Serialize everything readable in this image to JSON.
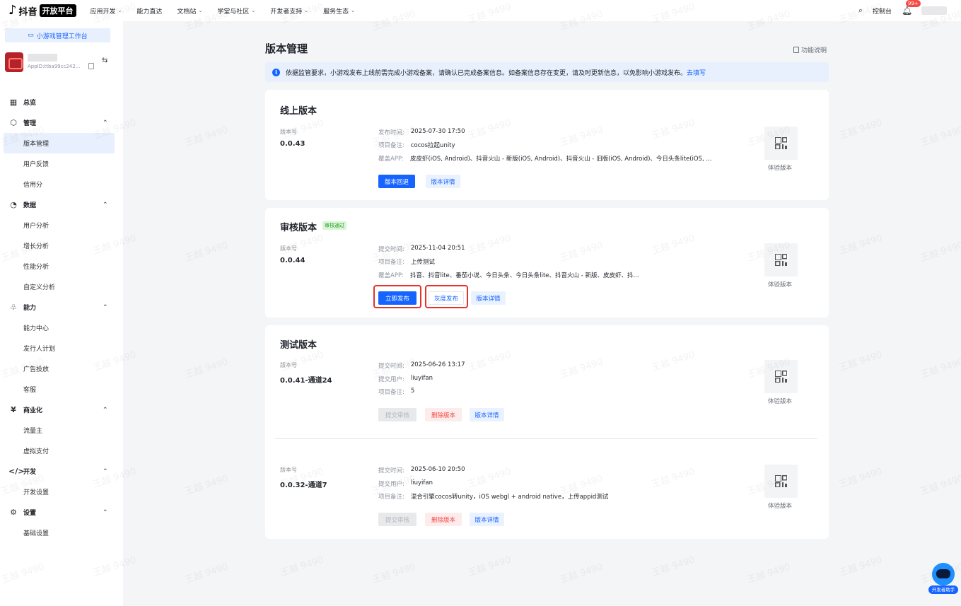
{
  "topnav": {
    "brand": "抖音",
    "badge": "开放平台",
    "items": [
      "应用开发",
      "能力直达",
      "文档站",
      "学堂与社区",
      "开发者支持",
      "服务生态"
    ],
    "console": "控制台",
    "notification_count": "99+"
  },
  "sidebar": {
    "workbench": "小游戏管理工作台",
    "app_id": "AppID:ttba99cc242...",
    "menu": [
      {
        "group": "总览",
        "icon": "overview-icon",
        "glyph": "▦",
        "expandable": false,
        "items": []
      },
      {
        "group": "管理",
        "icon": "cube-icon",
        "glyph": "⬡",
        "expandable": true,
        "items": [
          "版本管理",
          "用户反馈",
          "信用分"
        ]
      },
      {
        "group": "数据",
        "icon": "pie-chart-icon",
        "glyph": "◔",
        "expandable": true,
        "items": [
          "用户分析",
          "增长分析",
          "性能分析",
          "自定义分析"
        ]
      },
      {
        "group": "能力",
        "icon": "capability-icon",
        "glyph": "♧",
        "expandable": true,
        "items": [
          "能力中心",
          "发行人计划",
          "广告投放",
          "客服"
        ]
      },
      {
        "group": "商业化",
        "icon": "coin-icon",
        "glyph": "¥",
        "expandable": true,
        "items": [
          "流量主",
          "虚拟支付"
        ]
      },
      {
        "group": "开发",
        "icon": "code-icon",
        "glyph": "</>",
        "expandable": true,
        "items": [
          "开发设置"
        ]
      },
      {
        "group": "设置",
        "icon": "settings-icon",
        "glyph": "⚙",
        "expandable": true,
        "items": [
          "基础设置"
        ]
      }
    ],
    "active": "版本管理"
  },
  "main": {
    "title": "版本管理",
    "help": "功能说明",
    "notice": "依据监管要求，小游戏发布上线前需完成小游戏备案，请确认已完成备案信息。如备案信息存在变更，请及时更新信息，以免影响小游戏发布。",
    "notice_link": "去填写",
    "online": {
      "title": "线上版本",
      "ver_label": "版本号",
      "version": "0.0.43",
      "rows": [
        {
          "k": "发布时间:",
          "v": "2025-07-30 17:50"
        },
        {
          "k": "项目备注:",
          "v": "cocos拉起unity"
        },
        {
          "k": "覆盖APP:",
          "v": "皮皮虾(iOS, Android)、抖音火山 - 新版(iOS, Android)、抖音火山 - 旧版(iOS, Android)、今日头条lite(iOS, ..."
        }
      ],
      "btn_rollback": "版本回退",
      "btn_detail": "版本详情",
      "qr_label": "体验版本"
    },
    "review": {
      "title": "审核版本",
      "tag": "审核通过",
      "ver_label": "版本号",
      "version": "0.0.44",
      "rows": [
        {
          "k": "提交时间:",
          "v": "2025-11-04 20:51"
        },
        {
          "k": "项目备注:",
          "v": "上传测试"
        },
        {
          "k": "覆盖APP:",
          "v": "抖音、抖音lite、番茄小说、今日头条、今日头条lite、抖音火山 - 新版、皮皮虾、抖..."
        }
      ],
      "btn_publish": "立即发布",
      "btn_gray": "灰度发布",
      "btn_detail": "版本详情",
      "qr_label": "体验版本"
    },
    "test": {
      "title": "测试版本",
      "entries": [
        {
          "ver_label": "版本号",
          "version": "0.0.41-通道24",
          "rows": [
            {
              "k": "提交时间:",
              "v": "2025-06-26 13:17"
            },
            {
              "k": "提交用户:",
              "v": "liuyifan"
            },
            {
              "k": "项目备注:",
              "v": "5"
            }
          ],
          "btn_submit": "提交审核",
          "btn_delete": "删除版本",
          "btn_detail": "版本详情",
          "qr_label": "体验版本"
        },
        {
          "ver_label": "版本号",
          "version": "0.0.32-通道7",
          "rows": [
            {
              "k": "提交时间:",
              "v": "2025-06-10 20:50"
            },
            {
              "k": "提交用户:",
              "v": "liuyifan"
            },
            {
              "k": "项目备注:",
              "v": "混合引擎cocos转unity，iOS webgl + android native，上传appid测试"
            }
          ],
          "btn_submit": "提交审核",
          "btn_delete": "删除版本",
          "btn_detail": "版本详情",
          "qr_label": "体验版本"
        }
      ]
    }
  },
  "assistant": {
    "label": "开发者助手"
  },
  "watermark": "王越 9490"
}
